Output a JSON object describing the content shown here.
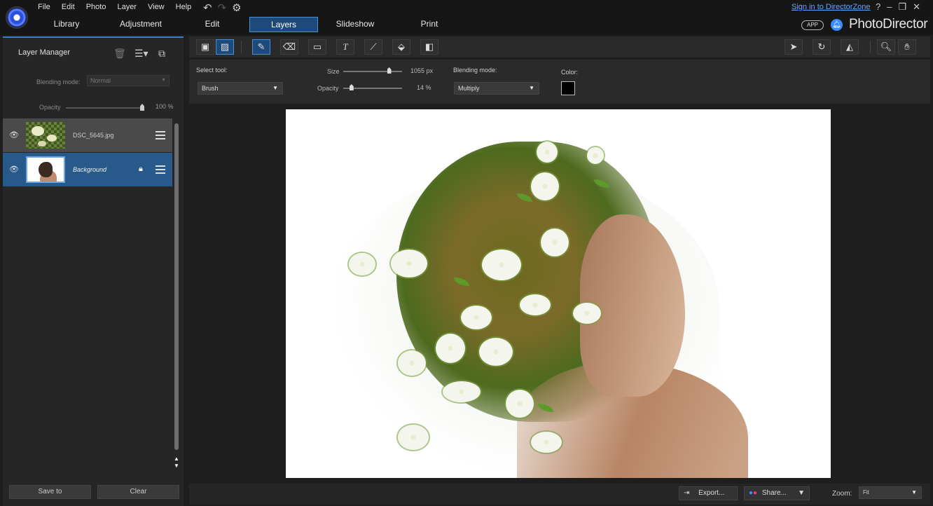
{
  "titlebar": {
    "menus": [
      "File",
      "Edit",
      "Photo",
      "Layer",
      "View",
      "Help"
    ],
    "modes": [
      "Library",
      "Adjustment",
      "Edit",
      "Layers",
      "Slideshow",
      "Print"
    ],
    "active_mode": "Layers",
    "sign_in": "Sign in to DirectorZone",
    "help": "?",
    "app_badge": "APP",
    "brand": "PhotoDirector"
  },
  "layer_manager": {
    "title": "Layer Manager",
    "blending_label": "Blending mode:",
    "blending_value": "Normal",
    "opacity_label": "Opacity",
    "opacity_value": "100",
    "opacity_unit": "%",
    "opacity_level": 1.0,
    "layers": [
      {
        "name": "DSC_5645.jpg",
        "locked": false,
        "selected": false
      },
      {
        "name": "Background",
        "locked": true,
        "selected": true
      }
    ],
    "save_label": "Save to",
    "clear_label": "Clear"
  },
  "options": {
    "select_tool_label": "Select tool:",
    "tool_value": "Brush",
    "size_label": "Size",
    "size_value": "1055",
    "size_unit": "px",
    "size_level": 0.78,
    "opacity_label": "Opacity",
    "opacity_value": "14",
    "opacity_unit": "%",
    "opacity_level": 0.14,
    "blending_label": "Blending mode:",
    "blending_value": "Multiply",
    "color_label": "Color:",
    "color_value": "#000000"
  },
  "bottom": {
    "export_label": "Export...",
    "share_label": "Share...",
    "zoom_label": "Zoom:",
    "zoom_value": "Fit"
  },
  "colors": {
    "accent": "#3d7cc9",
    "selected_layer": "#275a8a",
    "link": "#5fa9ff"
  }
}
